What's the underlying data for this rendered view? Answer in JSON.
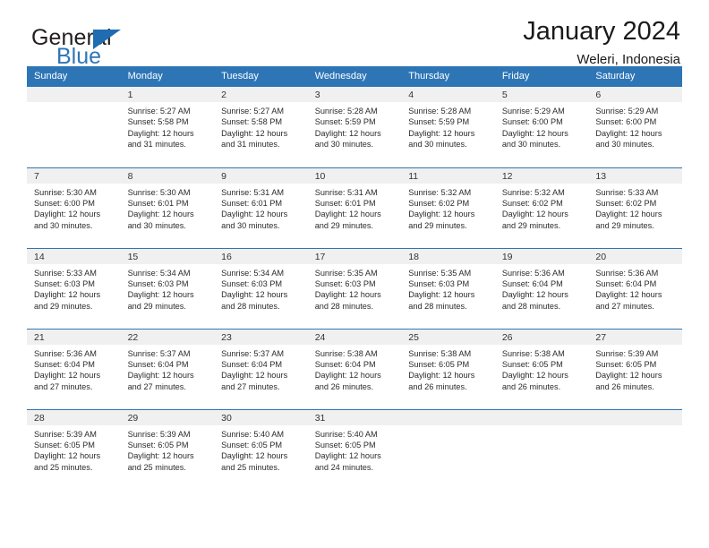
{
  "brand": {
    "name_part1": "General",
    "name_part2": "Blue",
    "triangle_color": "#1f6cb0",
    "blue_color": "#2e75b6"
  },
  "header": {
    "title": "January 2024",
    "subtitle": "Weleri, Indonesia"
  },
  "theme": {
    "header_bg": "#2e75b6",
    "header_text": "#ffffff",
    "daynum_band_bg": "#f0f0f0",
    "week_separator": "#2e75b6",
    "cell_bg": "#ffffff"
  },
  "columns": [
    "Sunday",
    "Monday",
    "Tuesday",
    "Wednesday",
    "Thursday",
    "Friday",
    "Saturday"
  ],
  "weeks": [
    [
      {
        "day": "",
        "lines": []
      },
      {
        "day": "1",
        "lines": [
          "Sunrise: 5:27 AM",
          "Sunset: 5:58 PM",
          "Daylight: 12 hours",
          "and 31 minutes."
        ]
      },
      {
        "day": "2",
        "lines": [
          "Sunrise: 5:27 AM",
          "Sunset: 5:58 PM",
          "Daylight: 12 hours",
          "and 31 minutes."
        ]
      },
      {
        "day": "3",
        "lines": [
          "Sunrise: 5:28 AM",
          "Sunset: 5:59 PM",
          "Daylight: 12 hours",
          "and 30 minutes."
        ]
      },
      {
        "day": "4",
        "lines": [
          "Sunrise: 5:28 AM",
          "Sunset: 5:59 PM",
          "Daylight: 12 hours",
          "and 30 minutes."
        ]
      },
      {
        "day": "5",
        "lines": [
          "Sunrise: 5:29 AM",
          "Sunset: 6:00 PM",
          "Daylight: 12 hours",
          "and 30 minutes."
        ]
      },
      {
        "day": "6",
        "lines": [
          "Sunrise: 5:29 AM",
          "Sunset: 6:00 PM",
          "Daylight: 12 hours",
          "and 30 minutes."
        ]
      }
    ],
    [
      {
        "day": "7",
        "lines": [
          "Sunrise: 5:30 AM",
          "Sunset: 6:00 PM",
          "Daylight: 12 hours",
          "and 30 minutes."
        ]
      },
      {
        "day": "8",
        "lines": [
          "Sunrise: 5:30 AM",
          "Sunset: 6:01 PM",
          "Daylight: 12 hours",
          "and 30 minutes."
        ]
      },
      {
        "day": "9",
        "lines": [
          "Sunrise: 5:31 AM",
          "Sunset: 6:01 PM",
          "Daylight: 12 hours",
          "and 30 minutes."
        ]
      },
      {
        "day": "10",
        "lines": [
          "Sunrise: 5:31 AM",
          "Sunset: 6:01 PM",
          "Daylight: 12 hours",
          "and 29 minutes."
        ]
      },
      {
        "day": "11",
        "lines": [
          "Sunrise: 5:32 AM",
          "Sunset: 6:02 PM",
          "Daylight: 12 hours",
          "and 29 minutes."
        ]
      },
      {
        "day": "12",
        "lines": [
          "Sunrise: 5:32 AM",
          "Sunset: 6:02 PM",
          "Daylight: 12 hours",
          "and 29 minutes."
        ]
      },
      {
        "day": "13",
        "lines": [
          "Sunrise: 5:33 AM",
          "Sunset: 6:02 PM",
          "Daylight: 12 hours",
          "and 29 minutes."
        ]
      }
    ],
    [
      {
        "day": "14",
        "lines": [
          "Sunrise: 5:33 AM",
          "Sunset: 6:03 PM",
          "Daylight: 12 hours",
          "and 29 minutes."
        ]
      },
      {
        "day": "15",
        "lines": [
          "Sunrise: 5:34 AM",
          "Sunset: 6:03 PM",
          "Daylight: 12 hours",
          "and 29 minutes."
        ]
      },
      {
        "day": "16",
        "lines": [
          "Sunrise: 5:34 AM",
          "Sunset: 6:03 PM",
          "Daylight: 12 hours",
          "and 28 minutes."
        ]
      },
      {
        "day": "17",
        "lines": [
          "Sunrise: 5:35 AM",
          "Sunset: 6:03 PM",
          "Daylight: 12 hours",
          "and 28 minutes."
        ]
      },
      {
        "day": "18",
        "lines": [
          "Sunrise: 5:35 AM",
          "Sunset: 6:03 PM",
          "Daylight: 12 hours",
          "and 28 minutes."
        ]
      },
      {
        "day": "19",
        "lines": [
          "Sunrise: 5:36 AM",
          "Sunset: 6:04 PM",
          "Daylight: 12 hours",
          "and 28 minutes."
        ]
      },
      {
        "day": "20",
        "lines": [
          "Sunrise: 5:36 AM",
          "Sunset: 6:04 PM",
          "Daylight: 12 hours",
          "and 27 minutes."
        ]
      }
    ],
    [
      {
        "day": "21",
        "lines": [
          "Sunrise: 5:36 AM",
          "Sunset: 6:04 PM",
          "Daylight: 12 hours",
          "and 27 minutes."
        ]
      },
      {
        "day": "22",
        "lines": [
          "Sunrise: 5:37 AM",
          "Sunset: 6:04 PM",
          "Daylight: 12 hours",
          "and 27 minutes."
        ]
      },
      {
        "day": "23",
        "lines": [
          "Sunrise: 5:37 AM",
          "Sunset: 6:04 PM",
          "Daylight: 12 hours",
          "and 27 minutes."
        ]
      },
      {
        "day": "24",
        "lines": [
          "Sunrise: 5:38 AM",
          "Sunset: 6:04 PM",
          "Daylight: 12 hours",
          "and 26 minutes."
        ]
      },
      {
        "day": "25",
        "lines": [
          "Sunrise: 5:38 AM",
          "Sunset: 6:05 PM",
          "Daylight: 12 hours",
          "and 26 minutes."
        ]
      },
      {
        "day": "26",
        "lines": [
          "Sunrise: 5:38 AM",
          "Sunset: 6:05 PM",
          "Daylight: 12 hours",
          "and 26 minutes."
        ]
      },
      {
        "day": "27",
        "lines": [
          "Sunrise: 5:39 AM",
          "Sunset: 6:05 PM",
          "Daylight: 12 hours",
          "and 26 minutes."
        ]
      }
    ],
    [
      {
        "day": "28",
        "lines": [
          "Sunrise: 5:39 AM",
          "Sunset: 6:05 PM",
          "Daylight: 12 hours",
          "and 25 minutes."
        ]
      },
      {
        "day": "29",
        "lines": [
          "Sunrise: 5:39 AM",
          "Sunset: 6:05 PM",
          "Daylight: 12 hours",
          "and 25 minutes."
        ]
      },
      {
        "day": "30",
        "lines": [
          "Sunrise: 5:40 AM",
          "Sunset: 6:05 PM",
          "Daylight: 12 hours",
          "and 25 minutes."
        ]
      },
      {
        "day": "31",
        "lines": [
          "Sunrise: 5:40 AM",
          "Sunset: 6:05 PM",
          "Daylight: 12 hours",
          "and 24 minutes."
        ]
      },
      {
        "day": "",
        "lines": []
      },
      {
        "day": "",
        "lines": []
      },
      {
        "day": "",
        "lines": []
      }
    ]
  ]
}
